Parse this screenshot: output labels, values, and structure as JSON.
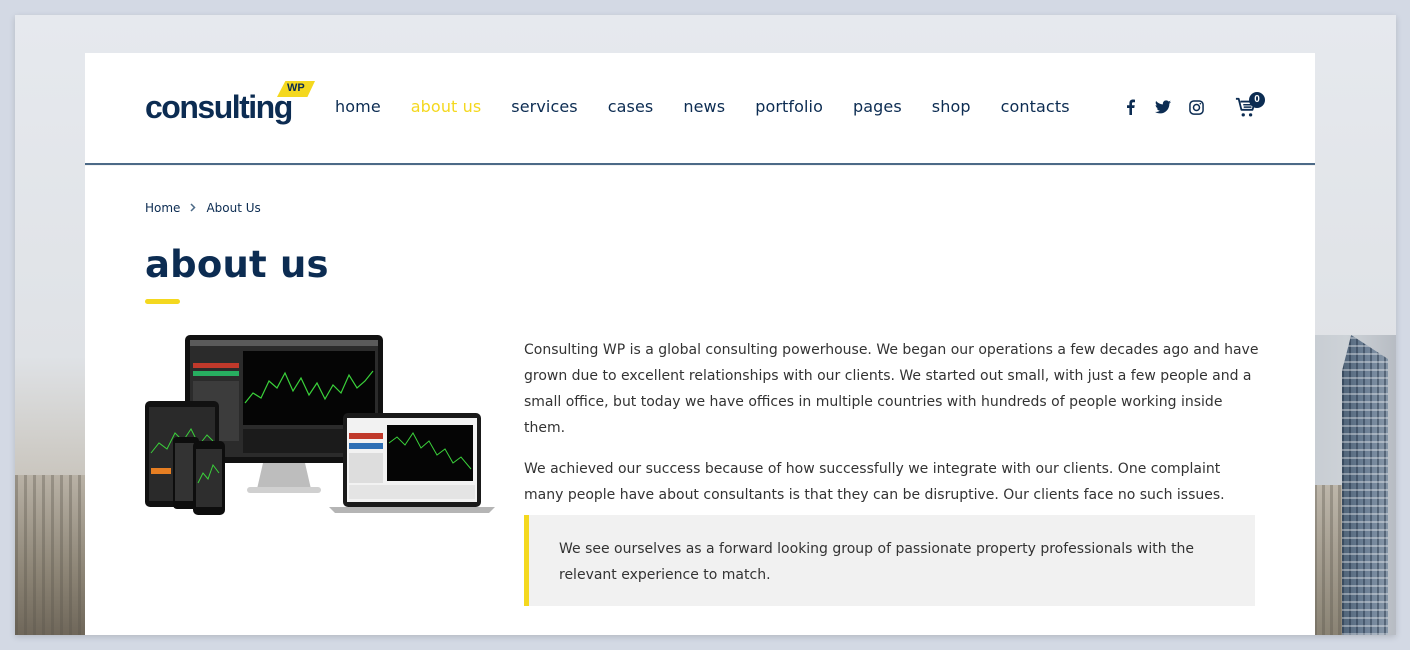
{
  "logo": {
    "text": "consulting",
    "badge": "WP"
  },
  "nav": {
    "items": [
      {
        "label": "home"
      },
      {
        "label": "about us",
        "active": true
      },
      {
        "label": "services"
      },
      {
        "label": "cases"
      },
      {
        "label": "news"
      },
      {
        "label": "portfolio"
      },
      {
        "label": "pages"
      },
      {
        "label": "shop"
      },
      {
        "label": "contacts"
      }
    ]
  },
  "social": {
    "icons": [
      "facebook-icon",
      "twitter-icon",
      "instagram-icon"
    ]
  },
  "cart": {
    "icon": "cart-icon",
    "count": "0"
  },
  "breadcrumb": {
    "home": "Home",
    "current": "About Us",
    "separator_icon": "chevron-right-icon"
  },
  "page": {
    "title": "about us"
  },
  "content": {
    "paragraph1": "Consulting WP is a global consulting powerhouse. We began our operations a few decades ago and have grown due to excellent relationships with our clients. We started out small, with just a few people and a small office, but today we have offices in multiple countries with hundreds of people working inside them.",
    "paragraph2": "We achieved our success because of how successfully we integrate with our clients. One complaint many people have about consultants is that they can be disruptive. Our clients face no such issues.",
    "quote": "We see ourselves as a forward looking group of passionate property professionals with the relevant experience to match."
  },
  "colors": {
    "navy": "#0c2c52",
    "accent": "#f4d81f",
    "quote_bg": "#f1f1f1"
  }
}
